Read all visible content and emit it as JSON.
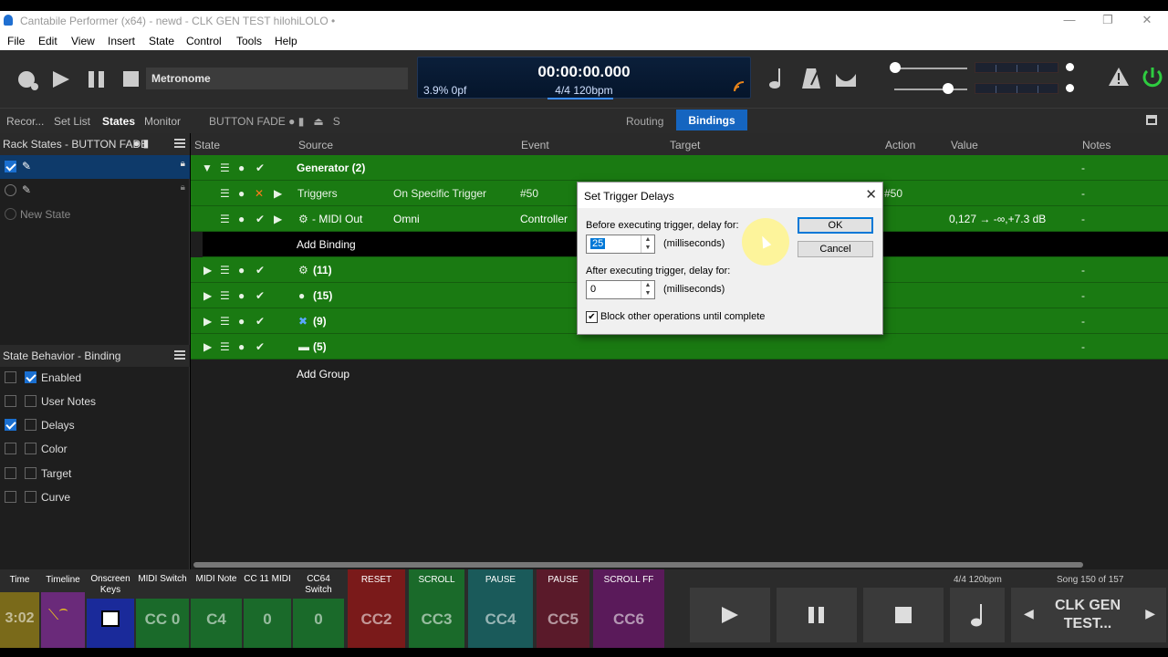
{
  "window": {
    "title": "Cantabile Performer (x64) - newd - CLK GEN TEST hilohiLOLO •"
  },
  "menu": [
    "File",
    "Edit",
    "View",
    "Insert",
    "State",
    "Control",
    "Tools",
    "Help"
  ],
  "toolbar": {
    "metronome_name": "Metronome",
    "lcd": {
      "time": "00:00:00.000",
      "cpu": "3.9%  0pf",
      "tempo": "4/4 120bpm"
    }
  },
  "left_tabs": [
    "Recor...",
    "Set List",
    "States",
    "Monitor"
  ],
  "rack_label": "BUTTON FADE",
  "rack_suffix": "S",
  "view_tabs": {
    "routing": "Routing",
    "bindings": "Bindings"
  },
  "rack_states": {
    "header": "Rack States - BUTTON FADE",
    "new_state": "New State"
  },
  "behavior": {
    "header": "State Behavior - Binding",
    "items": [
      {
        "label": "Enabled",
        "checked": true
      },
      {
        "label": "User Notes",
        "checked": false
      },
      {
        "label": "Delays",
        "checked": false
      },
      {
        "label": "Color",
        "checked": false
      },
      {
        "label": "Target",
        "checked": false
      },
      {
        "label": "Curve",
        "checked": false
      }
    ]
  },
  "columns": [
    "State",
    "Source",
    "Event",
    "Target",
    "Action",
    "Value",
    "Notes"
  ],
  "rows": {
    "group1": "Generator (2)",
    "triggers": {
      "name": "Triggers",
      "source": "On Specific Trigger",
      "event": "#50",
      "action": "#50",
      "notes": "-"
    },
    "midiout": {
      "name": "- MIDI Out",
      "source": "Omni",
      "event": "Controller",
      "value": "0,127 → -∞,+7.3 dB",
      "notes": "-"
    },
    "add_binding": "Add Binding",
    "g2": "(11)",
    "g3": "(15)",
    "g4": "(9)",
    "g5": "(5)",
    "add_group": "Add Group",
    "dash": "-"
  },
  "dialog": {
    "title": "Set Trigger Delays",
    "before_label": "Before executing trigger, delay for:",
    "before_value": "25",
    "after_label": "After executing trigger, delay for:",
    "after_value": "0",
    "units": "(milliseconds)",
    "block_label": "Block other operations until complete",
    "ok": "OK",
    "cancel": "Cancel"
  },
  "bottom": {
    "time": {
      "title": "Time",
      "value": "3:02"
    },
    "timeline": {
      "title": "Timeline"
    },
    "onscreen": {
      "title": "Onscreen Keys"
    },
    "midiswitch": {
      "title": "MIDI Switch",
      "value": "CC 0"
    },
    "midinote": {
      "title": "MIDI Note",
      "value": "C4"
    },
    "cc11": {
      "title": "CC 11 MIDI",
      "value": "0"
    },
    "cc64": {
      "title": "CC64 Switch",
      "value": "0"
    },
    "reset": {
      "title": "RESET",
      "value": "CC2"
    },
    "scroll": {
      "title": "SCROLL",
      "value": "CC3"
    },
    "pause1": {
      "title": "PAUSE",
      "value": "CC4"
    },
    "pause2": {
      "title": "PAUSE",
      "value": "CC5"
    },
    "scrollff": {
      "title": "SCROLL FF",
      "value": "CC6"
    },
    "tempo": "4/4 120bpm",
    "song_pos": "Song 150 of 157",
    "song_name": "CLK GEN TEST..."
  },
  "colors": {
    "accent": "#1565c0",
    "row_green": "#1a7a12",
    "power": "#2ecc40"
  }
}
